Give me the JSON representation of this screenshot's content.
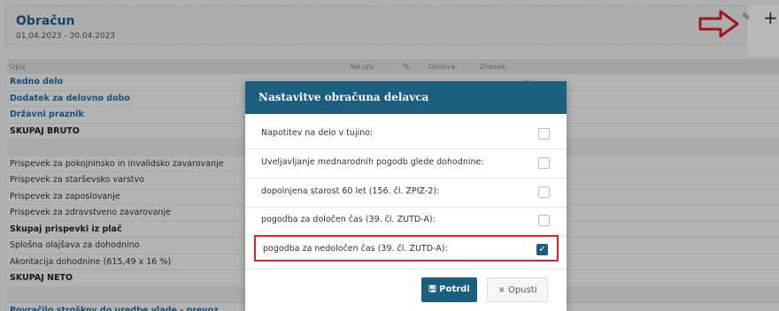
{
  "panel": {
    "title": "Obračun",
    "period": "01.04.2023 - 30.04.2023",
    "pencil_glyph": "✎",
    "plus_glyph": "+"
  },
  "table": {
    "columns": [
      "Opis",
      "Na uro",
      "%",
      "Osnova",
      "Znesek"
    ],
    "rows": [
      {
        "label": "Redno delo",
        "style": "link"
      },
      {
        "label": "Dodatek za delovno dobo",
        "style": "link"
      },
      {
        "label": "Državni praznik",
        "style": "link"
      },
      {
        "label": "SKUPAJ BRUTO",
        "style": "bold"
      },
      {
        "label": "",
        "style": "gap"
      },
      {
        "label": "Prispevek za pokojninsko in invalidsko zavarovanje",
        "style": "normal"
      },
      {
        "label": "Prispevek za starševsko varstvo",
        "style": "normal"
      },
      {
        "label": "Prispevek za zaposlovanje",
        "style": "normal"
      },
      {
        "label": "Prispevek za zdravstveno zavarovanje",
        "style": "normal"
      },
      {
        "label": "Skupaj prispevki iz plač",
        "style": "bold"
      },
      {
        "label": "Splošna olajšava za dohodnino",
        "style": "normal"
      },
      {
        "label": "Akontacija dohodnine (615,49 x 16 %)",
        "style": "normal"
      },
      {
        "label": "SKUPAJ NETO",
        "style": "bold"
      },
      {
        "label": "",
        "style": "gap"
      },
      {
        "label": "Povračilo stroškov do uredbe vlade - prevoz",
        "style": "link"
      }
    ]
  },
  "modal": {
    "title": "Nastavitve obračuna delavca",
    "options": [
      {
        "label": "Napotitev na delo v tujino:",
        "checked": false
      },
      {
        "label": "Uveljavljanje mednarodnih pogodb glede dohodnine:",
        "checked": false
      },
      {
        "label": "dopolnjena starost 60 let (156. čl. ZPIZ-2):",
        "checked": false
      },
      {
        "label": "pogodba za določen čas (39. čl. ZUTD-A):",
        "checked": false
      },
      {
        "label": "pogodba za nedoločen čas (39. čl. ZUTD-A):",
        "checked": true
      }
    ],
    "confirm_label": "Potrdi",
    "cancel_label": "Opusti",
    "close_glyph": "×",
    "check_glyph": "✓",
    "confirm_icon": "save-icon",
    "cancel_icon": "close-icon"
  },
  "colors": {
    "accent": "#1b5e7e",
    "highlight": "#e0202a",
    "link": "#1f6fa5"
  }
}
